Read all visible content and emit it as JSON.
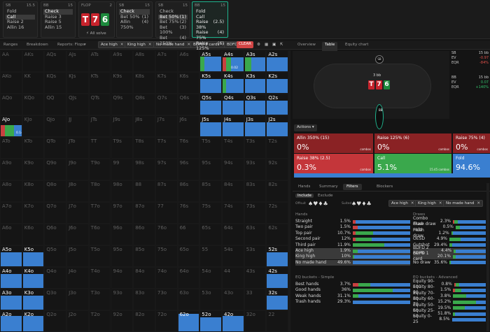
{
  "columns": [
    {
      "head": "SB",
      "stack": "15.5",
      "items": [
        "Fold",
        "Call",
        "Raise 2",
        "Allin 16"
      ],
      "sel": 1
    },
    {
      "head": "BB",
      "stack": "15",
      "items": [
        "Check",
        "Raise 3",
        "Raise 5",
        "Allin 15"
      ],
      "sel": 0
    },
    {
      "head": "SB",
      "stack": "15",
      "items": [
        "Check",
        "Bet 50%",
        "Allin 750%"
      ],
      "sel": 0,
      "vals": [
        "",
        "(1)",
        "(4)"
      ]
    },
    {
      "head": "SB",
      "stack": "15",
      "items": [
        "Check",
        "Bet 50%",
        "Bet 75%",
        "Bet 100%",
        "Bet 150%"
      ],
      "sel": 1,
      "vals": [
        "",
        "(1)",
        "(2)",
        "(3)",
        "(4)"
      ]
    },
    {
      "head": "BB",
      "stack": "15",
      "items": [
        "Fold",
        "Call",
        "Raise 38%",
        "Raise 75%",
        "Raise 125%"
      ],
      "sel": -1,
      "vals": [
        "",
        "",
        "(2.5)",
        "(4)",
        "(6)"
      ]
    }
  ],
  "flop": {
    "label": "FLOP",
    "pot": "2",
    "cards": [
      {
        "r": "T",
        "c": "red"
      },
      {
        "r": "7",
        "c": "red"
      },
      {
        "r": "6",
        "c": "green"
      }
    ],
    "all_solve": "All solve"
  },
  "left_tabs": [
    "Ranges",
    "Breakdown",
    "Reports: Flops"
  ],
  "chips": [
    "Ace high",
    "King high",
    "No made hand",
    "BDFD 2 cards",
    "BDFD"
  ],
  "clear_label": "CLEAR",
  "grid_labels": [
    [
      "AA",
      "AKs",
      "AQs",
      "AJs",
      "ATs",
      "A9s",
      "A8s",
      "A7s",
      "A6s",
      "A5s",
      "A4s",
      "A3s",
      "A2s"
    ],
    [
      "AKo",
      "KK",
      "KQs",
      "KJs",
      "KTs",
      "K9s",
      "K8s",
      "K7s",
      "K6s",
      "K5s",
      "K4s",
      "K3s",
      "K2s"
    ],
    [
      "AQo",
      "KQo",
      "QQ",
      "QJs",
      "QTs",
      "Q9s",
      "Q8s",
      "Q7s",
      "Q6s",
      "Q5s",
      "Q4s",
      "Q3s",
      "Q2s"
    ],
    [
      "AJo",
      "KJo",
      "QJo",
      "JJ",
      "JTs",
      "J9s",
      "J8s",
      "J7s",
      "J6s",
      "J5s",
      "J4s",
      "J3s",
      "J2s"
    ],
    [
      "ATo",
      "KTo",
      "QTo",
      "JTo",
      "TT",
      "T9s",
      "T8s",
      "T7s",
      "T6s",
      "T5s",
      "T4s",
      "T3s",
      "T2s"
    ],
    [
      "A9o",
      "K9o",
      "Q9o",
      "J9o",
      "T9o",
      "99",
      "98s",
      "97s",
      "96s",
      "95s",
      "94s",
      "93s",
      "92s"
    ],
    [
      "A8o",
      "K8o",
      "Q8o",
      "J8o",
      "T8o",
      "98o",
      "88",
      "87s",
      "86s",
      "85s",
      "84s",
      "83s",
      "82s"
    ],
    [
      "A7o",
      "K7o",
      "Q7o",
      "J7o",
      "T7o",
      "97o",
      "87o",
      "77",
      "76s",
      "75s",
      "74s",
      "73s",
      "72s"
    ],
    [
      "A6o",
      "K6o",
      "Q6o",
      "J6o",
      "T6o",
      "96o",
      "86o",
      "76o",
      "66",
      "65s",
      "64s",
      "63s",
      "62s"
    ],
    [
      "A5o",
      "K5o",
      "Q5o",
      "J5o",
      "T5o",
      "95o",
      "85o",
      "75o",
      "65o",
      "55",
      "54s",
      "53s",
      "52s"
    ],
    [
      "A4o",
      "K4o",
      "Q4o",
      "J4o",
      "T4o",
      "94o",
      "84o",
      "74o",
      "64o",
      "54o",
      "44",
      "43s",
      "42s"
    ],
    [
      "A3o",
      "K3o",
      "Q3o",
      "J3o",
      "T3o",
      "93o",
      "83o",
      "73o",
      "63o",
      "53o",
      "43o",
      "33",
      "32s"
    ],
    [
      "A2o",
      "K2o",
      "Q2o",
      "J2o",
      "T2o",
      "92o",
      "82o",
      "72o",
      "62o",
      "52o",
      "42o",
      "32o",
      "22"
    ]
  ],
  "right_tabs": [
    "Overview",
    "Table",
    "Equity chart"
  ],
  "table": {
    "pot": "3 bb",
    "cards": [
      {
        "r": "T",
        "c": "red"
      },
      {
        "r": "7",
        "c": "red"
      },
      {
        "r": "6",
        "c": "green"
      }
    ],
    "seat_top": "SB",
    "seat_bottom": "BB"
  },
  "stats": [
    {
      "h": "SB",
      "v": "15 bb"
    },
    {
      "h": "EV",
      "v": "-0.97",
      "c": "neg"
    },
    {
      "h": "EQR",
      "v": "-84%",
      "c": "neg"
    },
    {
      "h": "BB",
      "v": "15 bb"
    },
    {
      "h": "EV",
      "v": "0.07",
      "c": "pos"
    },
    {
      "h": "EQR",
      "v": "+140%",
      "c": "pos"
    }
  ],
  "actions_label": "Actions",
  "actions": [
    {
      "t": "Allin 350% (15)",
      "p": "0%",
      "c": "combos",
      "bg": "#8a2224"
    },
    {
      "t": "Raise 125% (6)",
      "p": "0%",
      "c": "combos",
      "bg": "#8a2224"
    },
    {
      "t": "Raise 75% (4)",
      "p": "0%",
      "c": "combos",
      "bg": "#8a2224"
    },
    {
      "t": "Raise 38% (2.5)",
      "p": "0.3%",
      "c": "combos",
      "bg": "#c4363a"
    },
    {
      "t": "Call",
      "p": "5.1%",
      "c": "15.45 combos",
      "bg": "#3aa84c"
    },
    {
      "t": "Fold",
      "p": "94.6%",
      "c": "",
      "bg": "#3a7fd0"
    }
  ],
  "sub_tabs": [
    "Hands",
    "Summary",
    "Filters",
    "Blockers"
  ],
  "filter": {
    "include": "Include",
    "exclude": "Exclude",
    "offsuit": "Offsuit",
    "suited": "Suited",
    "chips": [
      "Ace high",
      "King high",
      "No made hand"
    ]
  },
  "hands_title": "Hands",
  "hands": [
    {
      "n": "Straight",
      "v": "1.5%",
      "b": [
        5,
        0,
        95
      ]
    },
    {
      "n": "Two pair",
      "v": "1.5%",
      "b": [
        8,
        0,
        92
      ]
    },
    {
      "n": "Top pair",
      "v": "10.7%",
      "b": [
        5,
        30,
        65
      ]
    },
    {
      "n": "Second pair",
      "v": "12%",
      "b": [
        5,
        28,
        67
      ]
    },
    {
      "n": "Third pair",
      "v": "11.9%",
      "b": [
        0,
        55,
        45
      ]
    },
    {
      "n": "Ace high",
      "v": "1.9%",
      "b": [
        0,
        8,
        92
      ]
    },
    {
      "n": "King high",
      "v": "10%",
      "b": [
        0,
        2,
        98
      ]
    },
    {
      "n": "No made hand",
      "v": "49.6%",
      "b": [
        0,
        0,
        100
      ]
    }
  ],
  "draws_title": "Draws",
  "draws": [
    {
      "n": "Combo draw",
      "v": "2.3%",
      "b": [
        5,
        10,
        85
      ]
    },
    {
      "n": "Flush draw nuts",
      "v": "0.5%",
      "b": [
        0,
        15,
        85
      ]
    },
    {
      "n": "Flush draw",
      "v": "1.2%",
      "b": [
        0,
        5,
        95
      ]
    },
    {
      "n": "OESD",
      "v": "4.9%",
      "b": [
        0,
        30,
        70
      ]
    },
    {
      "n": "Gutshot",
      "v": "29.4%",
      "b": [
        0,
        8,
        92
      ]
    },
    {
      "n": "BDFD 2 cards",
      "v": "4.4%",
      "b": [
        0,
        5,
        95
      ]
    },
    {
      "n": "BDFD 1 card",
      "v": "20.1%",
      "b": [
        0,
        8,
        92
      ]
    },
    {
      "n": "No draw",
      "v": "35.6%",
      "b": [
        0,
        3,
        97
      ]
    }
  ],
  "eq_simple_title": "EQ buckets - Simple",
  "eq_simple": [
    {
      "n": "Best hands",
      "v": "3.7%",
      "b": [
        10,
        20,
        70
      ]
    },
    {
      "n": "Good hands",
      "v": "36%",
      "b": [
        0,
        70,
        30
      ]
    },
    {
      "n": "Weak hands",
      "v": "31.1%",
      "b": [
        0,
        10,
        90
      ]
    },
    {
      "n": "Trash hands",
      "v": "29.3%",
      "b": [
        0,
        0,
        100
      ]
    }
  ],
  "eq_adv_title": "EQ buckets - Advanced",
  "eq_adv": [
    {
      "n": "Equity 90-100",
      "v": "0.8%",
      "b": [
        5,
        10,
        85
      ]
    },
    {
      "n": "Equity 80-90",
      "v": "1.5%",
      "b": [
        5,
        20,
        75
      ]
    },
    {
      "n": "Equity 70-80",
      "v": "3.8%",
      "b": [
        0,
        40,
        60
      ]
    },
    {
      "n": "Equity 60-70",
      "v": "15.2%",
      "b": [
        0,
        70,
        30
      ]
    },
    {
      "n": "Equity 50-60",
      "v": "19.5%",
      "b": [
        0,
        35,
        65
      ]
    },
    {
      "n": "Equity 25-50",
      "v": "51.8%",
      "b": [
        0,
        5,
        95
      ]
    },
    {
      "n": "Equity 0-25",
      "v": "8.5%",
      "b": [
        0,
        0,
        100
      ]
    }
  ],
  "grid_numbers": {
    "a": "0.02",
    "b": "0.14"
  }
}
